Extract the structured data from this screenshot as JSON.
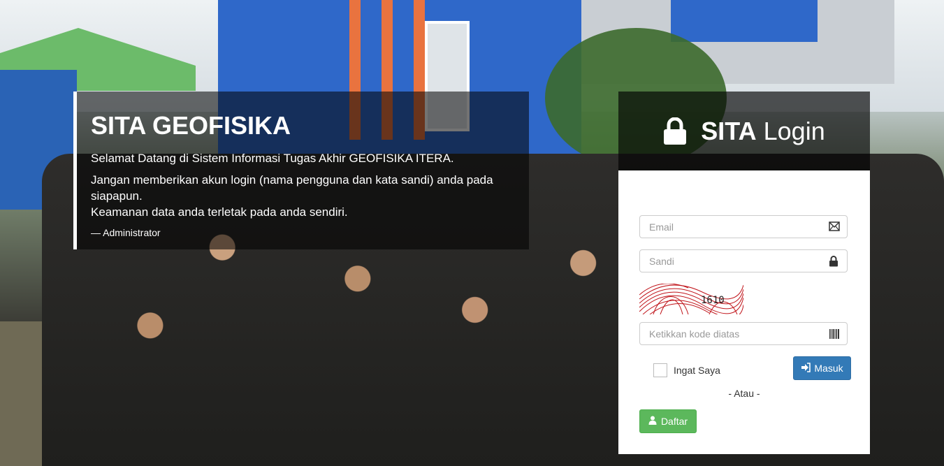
{
  "welcome": {
    "title": "SITA GEOFISIKA",
    "greeting": "Selamat Datang di Sistem Informasi Tugas Akhir GEOFISIKA ITERA.",
    "warning_line1": "Jangan memberikan akun login (nama pengguna dan kata sandi) anda pada siapapun.",
    "warning_line2": "Keamanan data anda terletak pada anda sendiri.",
    "signature": "— Administrator"
  },
  "login": {
    "title_bold": "SITA",
    "title_rest": "Login",
    "email_placeholder": "Email",
    "password_placeholder": "Sandi",
    "captcha_text": "1610",
    "captcha_placeholder": "Ketikkan kode diatas",
    "remember_label": "Ingat Saya",
    "login_button": "Masuk",
    "or_text": "- Atau -",
    "register_button": "Daftar"
  },
  "icons": {
    "header": "lock-icon",
    "email": "envelope-icon",
    "password": "lock-icon",
    "captcha": "barcode-icon",
    "login": "sign-in-icon",
    "register": "user-icon"
  },
  "colors": {
    "primary": "#337ab7",
    "success": "#5cb85c",
    "overlay": "#000000"
  }
}
